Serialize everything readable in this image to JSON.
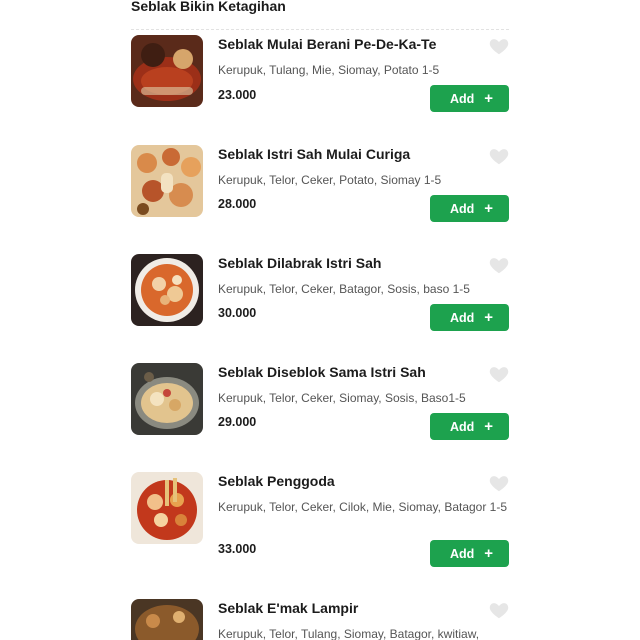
{
  "section": {
    "title": "Seblak Bikin Ketagihan"
  },
  "colors": {
    "accent": "#1da24e",
    "heart": "#e6e6e6"
  },
  "menu": {
    "items": [
      {
        "name": "Seblak Mulai Berani Pe-De-Ka-Te",
        "desc": "Kerupuk, Tulang, Mie, Siomay, Potato 1-5",
        "price": "23.000",
        "add_label": "Add",
        "add_icon": "+",
        "favorite_icon": "heart-icon"
      },
      {
        "name": "Seblak Istri Sah Mulai Curiga",
        "desc": "Kerupuk, Telor, Ceker, Potato, Siomay 1-5",
        "price": "28.000",
        "add_label": "Add",
        "add_icon": "+",
        "favorite_icon": "heart-icon"
      },
      {
        "name": "Seblak Dilabrak Istri Sah",
        "desc": "Kerupuk, Telor, Ceker, Batagor, Sosis, baso 1-5",
        "price": "30.000",
        "add_label": "Add",
        "add_icon": "+",
        "favorite_icon": "heart-icon"
      },
      {
        "name": "Seblak Diseblok Sama Istri Sah",
        "desc": "Kerupuk, Telor, Ceker, Siomay, Sosis, Baso1-5",
        "price": "29.000",
        "add_label": "Add",
        "add_icon": "+",
        "favorite_icon": "heart-icon"
      },
      {
        "name": "Seblak Penggoda",
        "desc": "Kerupuk, Telor, Ceker, Cilok, Mie, Siomay, Batagor 1-5",
        "price": "33.000",
        "add_label": "Add",
        "add_icon": "+",
        "favorite_icon": "heart-icon"
      },
      {
        "name": "Seblak E'mak Lampir",
        "desc": "Kerupuk, Telor, Tulang, Siomay, Batagor, kwitiaw,",
        "price": "",
        "add_label": "",
        "add_icon": "",
        "favorite_icon": "heart-icon"
      }
    ]
  }
}
